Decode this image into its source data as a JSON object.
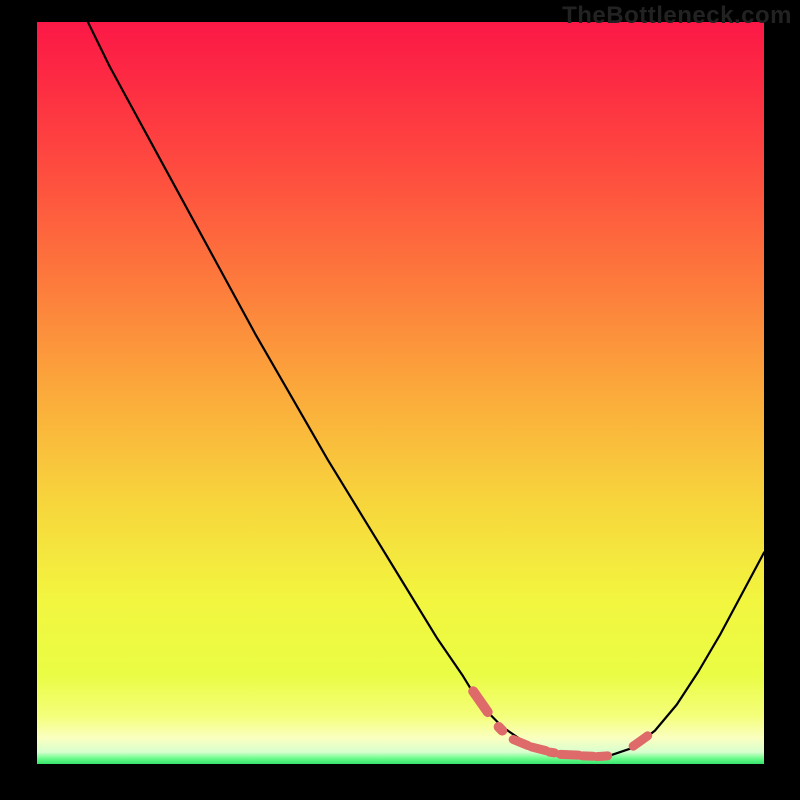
{
  "watermark": "TheBottleneck.com",
  "colors": {
    "background": "#000000",
    "curve": "#000000",
    "marker_fill": "#de6a6a",
    "gradient_stops": [
      {
        "offset": 0.0,
        "color": "#fc1846"
      },
      {
        "offset": 0.08,
        "color": "#fd2b43"
      },
      {
        "offset": 0.2,
        "color": "#fe4c3f"
      },
      {
        "offset": 0.35,
        "color": "#fd7a3c"
      },
      {
        "offset": 0.5,
        "color": "#fbaa3b"
      },
      {
        "offset": 0.65,
        "color": "#f7d63c"
      },
      {
        "offset": 0.78,
        "color": "#f2f63f"
      },
      {
        "offset": 0.88,
        "color": "#eafc44"
      },
      {
        "offset": 0.935,
        "color": "#f4ff7a"
      },
      {
        "offset": 0.965,
        "color": "#faffc0"
      },
      {
        "offset": 0.984,
        "color": "#d8ffcf"
      },
      {
        "offset": 0.992,
        "color": "#71fd8e"
      },
      {
        "offset": 1.0,
        "color": "#34e36b"
      }
    ]
  },
  "chart_data": {
    "type": "line",
    "title": "",
    "xlabel": "",
    "ylabel": "",
    "xlim": [
      0,
      100
    ],
    "ylim": [
      0,
      100
    ],
    "grid": false,
    "legend": false,
    "series": [
      {
        "name": "bottleneck-curve",
        "x": [
          7.0,
          10.0,
          15.0,
          20.0,
          25.0,
          30.0,
          35.0,
          40.0,
          45.0,
          50.0,
          55.0,
          58.5,
          61.0,
          64.0,
          67.0,
          70.0,
          73.0,
          76.0,
          79.0,
          82.0,
          85.0,
          88.0,
          91.0,
          94.0,
          97.0,
          100.0
        ],
        "y": [
          100.0,
          94.0,
          85.0,
          76.0,
          67.0,
          58.0,
          49.5,
          41.0,
          33.0,
          25.0,
          17.0,
          12.0,
          8.0,
          5.0,
          3.0,
          1.8,
          1.2,
          1.0,
          1.2,
          2.2,
          4.5,
          8.0,
          12.5,
          17.5,
          23.0,
          28.5
        ]
      }
    ],
    "markers": {
      "name": "highlight-segments",
      "segments": [
        {
          "x1": 60.0,
          "y1": 9.8,
          "x2": 62.0,
          "y2": 7.0,
          "w": 10
        },
        {
          "x1": 63.5,
          "y1": 5.0,
          "x2": 64.0,
          "y2": 4.5,
          "w": 10
        },
        {
          "x1": 65.5,
          "y1": 3.3,
          "x2": 67.5,
          "y2": 2.5,
          "w": 9
        },
        {
          "x1": 68.0,
          "y1": 2.3,
          "x2": 70.0,
          "y2": 1.8,
          "w": 9
        },
        {
          "x1": 70.5,
          "y1": 1.6,
          "x2": 71.2,
          "y2": 1.5,
          "w": 9
        },
        {
          "x1": 72.0,
          "y1": 1.3,
          "x2": 74.5,
          "y2": 1.2,
          "w": 9
        },
        {
          "x1": 75.0,
          "y1": 1.1,
          "x2": 76.5,
          "y2": 1.05,
          "w": 9
        },
        {
          "x1": 77.0,
          "y1": 1.0,
          "x2": 78.5,
          "y2": 1.1,
          "w": 9
        },
        {
          "x1": 82.0,
          "y1": 2.4,
          "x2": 84.0,
          "y2": 3.8,
          "w": 9
        }
      ]
    }
  }
}
